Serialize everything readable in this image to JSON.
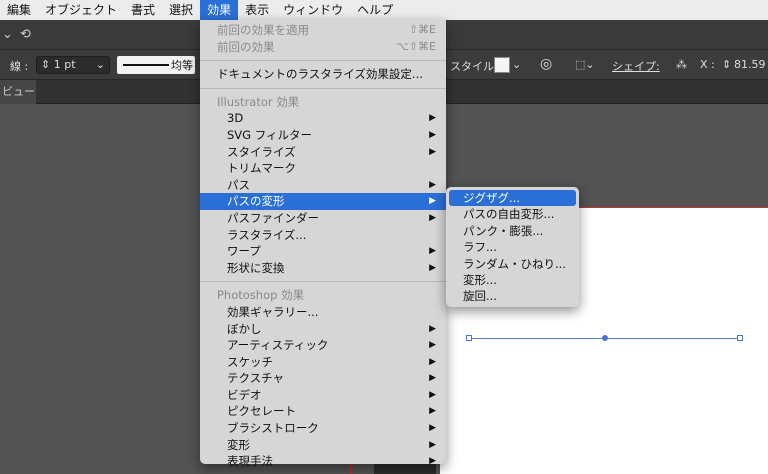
{
  "menubar": {
    "items": [
      "編集",
      "オブジェクト",
      "書式",
      "選択",
      "効果",
      "表示",
      "ウィンドウ",
      "ヘルプ"
    ],
    "active_index": 4
  },
  "control_bar": {
    "stroke_label": "線 :",
    "stroke_weight": "1 pt",
    "stroke_profile": "均等",
    "style_label": "スタイル :",
    "shape_label": "シェイプ:",
    "x_label": "X :",
    "x_value": "81.59"
  },
  "tab": {
    "label": "ビュー)"
  },
  "effect_menu": {
    "apply_last": {
      "label": "前回の効果を適用",
      "shortcut": "⇧⌘E"
    },
    "last_effect": {
      "label": "前回の効果",
      "shortcut": "⌥⇧⌘E"
    },
    "document_raster": "ドキュメントのラスタライズ効果設定...",
    "illustrator_header": "Illustrator 効果",
    "illustrator_items": [
      {
        "label": "3D",
        "sub": true
      },
      {
        "label": "SVG フィルター",
        "sub": true
      },
      {
        "label": "スタイライズ",
        "sub": true
      },
      {
        "label": "トリムマーク",
        "sub": false
      },
      {
        "label": "パス",
        "sub": true
      },
      {
        "label": "パスの変形",
        "sub": true
      },
      {
        "label": "パスファインダー",
        "sub": true
      },
      {
        "label": "ラスタライズ...",
        "sub": false
      },
      {
        "label": "ワープ",
        "sub": true
      },
      {
        "label": "形状に変換",
        "sub": true
      }
    ],
    "photoshop_header": "Photoshop 効果",
    "photoshop_items": [
      {
        "label": "効果ギャラリー...",
        "sub": false
      },
      {
        "label": "ぼかし",
        "sub": true
      },
      {
        "label": "アーティスティック",
        "sub": true
      },
      {
        "label": "スケッチ",
        "sub": true
      },
      {
        "label": "テクスチャ",
        "sub": true
      },
      {
        "label": "ビデオ",
        "sub": true
      },
      {
        "label": "ピクセレート",
        "sub": true
      },
      {
        "label": "ブラシストローク",
        "sub": true
      },
      {
        "label": "変形",
        "sub": true
      },
      {
        "label": "表現手法",
        "sub": true
      }
    ]
  },
  "submenu": {
    "items": [
      "ジグザグ...",
      "パスの自由変形...",
      "パンク・膨張...",
      "ラフ...",
      "ランダム・ひねり...",
      "変形...",
      "旋回..."
    ]
  },
  "colors": {
    "highlight": "#2a6fd6",
    "artboard_border": "#c9302c",
    "path": "#5a80d8"
  }
}
